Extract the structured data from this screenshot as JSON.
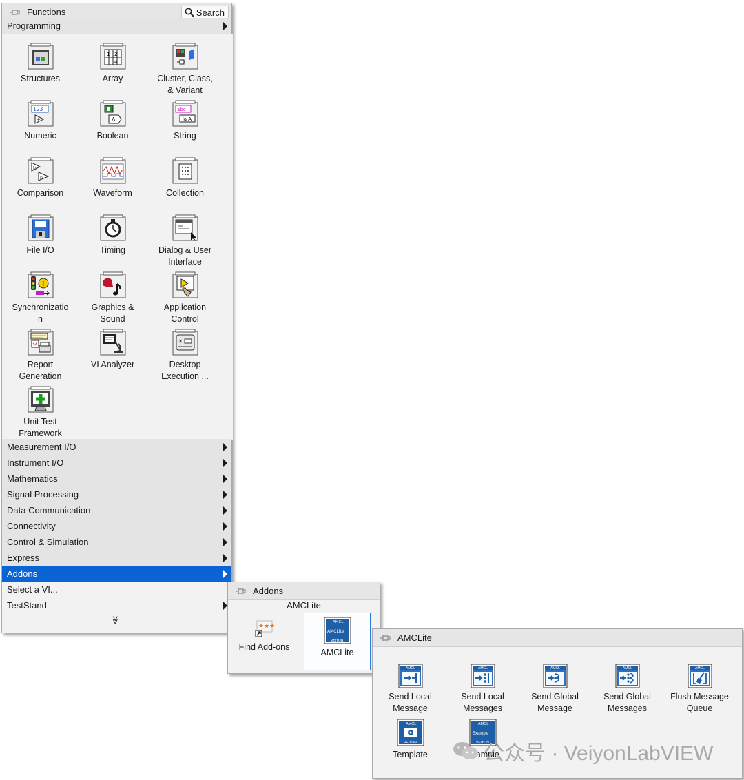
{
  "functions_palette": {
    "title": "Functions",
    "search_label": "Search",
    "programming": {
      "label": "Programming"
    },
    "icons": [
      {
        "label1": "Structures",
        "label2": ""
      },
      {
        "label1": "Array",
        "label2": ""
      },
      {
        "label1": "Cluster, Class,",
        "label2": "& Variant"
      },
      {
        "label1": "Numeric",
        "label2": ""
      },
      {
        "label1": "Boolean",
        "label2": ""
      },
      {
        "label1": "String",
        "label2": ""
      },
      {
        "label1": "Comparison",
        "label2": ""
      },
      {
        "label1": "Waveform",
        "label2": ""
      },
      {
        "label1": "Collection",
        "label2": ""
      },
      {
        "label1": "File I/O",
        "label2": ""
      },
      {
        "label1": "Timing",
        "label2": ""
      },
      {
        "label1": "Dialog & User",
        "label2": "Interface"
      },
      {
        "label1": "Synchronizatio",
        "label2": "n"
      },
      {
        "label1": "Graphics &",
        "label2": "Sound"
      },
      {
        "label1": "Application",
        "label2": "Control"
      },
      {
        "label1": "Report",
        "label2": "Generation"
      },
      {
        "label1": "VI Analyzer",
        "label2": ""
      },
      {
        "label1": "Desktop",
        "label2": "Execution ..."
      },
      {
        "label1": "Unit Test",
        "label2": "Framework"
      }
    ],
    "categories": [
      {
        "label": "Measurement I/O"
      },
      {
        "label": "Instrument I/O"
      },
      {
        "label": "Mathematics"
      },
      {
        "label": "Signal Processing"
      },
      {
        "label": "Data Communication"
      },
      {
        "label": "Connectivity"
      },
      {
        "label": "Control & Simulation"
      },
      {
        "label": "Express"
      },
      {
        "label": "Addons"
      },
      {
        "label": "Select a VI..."
      },
      {
        "label": "TestStand"
      }
    ],
    "more_glyph": "≫"
  },
  "addons_palette": {
    "title": "Addons",
    "header": "AMCLite",
    "items": [
      {
        "label": "Find Add-ons"
      },
      {
        "label": "AMCLite"
      }
    ]
  },
  "amclite_palette": {
    "title": "AMCLite",
    "items": [
      {
        "label1": "Send Local",
        "label2": "Message"
      },
      {
        "label1": "Send Local",
        "label2": "Messages"
      },
      {
        "label1": "Send Global",
        "label2": "Message"
      },
      {
        "label1": "Send Global",
        "label2": "Messages"
      },
      {
        "label1": "Flush Message",
        "label2": "Queue"
      },
      {
        "label1": "Template",
        "label2": ""
      },
      {
        "label1": "Example",
        "label2": ""
      }
    ],
    "icon_badge_top": "AMCL",
    "icon_badge_bottom": "VEIYON",
    "icon_center_text": "AMCLite",
    "icon_example_text": "Example"
  },
  "watermark": {
    "text": "公众号 · VeiyonLabVIEW"
  },
  "colors": {
    "selection": "#0a64d6",
    "amcl_blue": "#1f5fa8",
    "panel": "#f2f2f2"
  }
}
